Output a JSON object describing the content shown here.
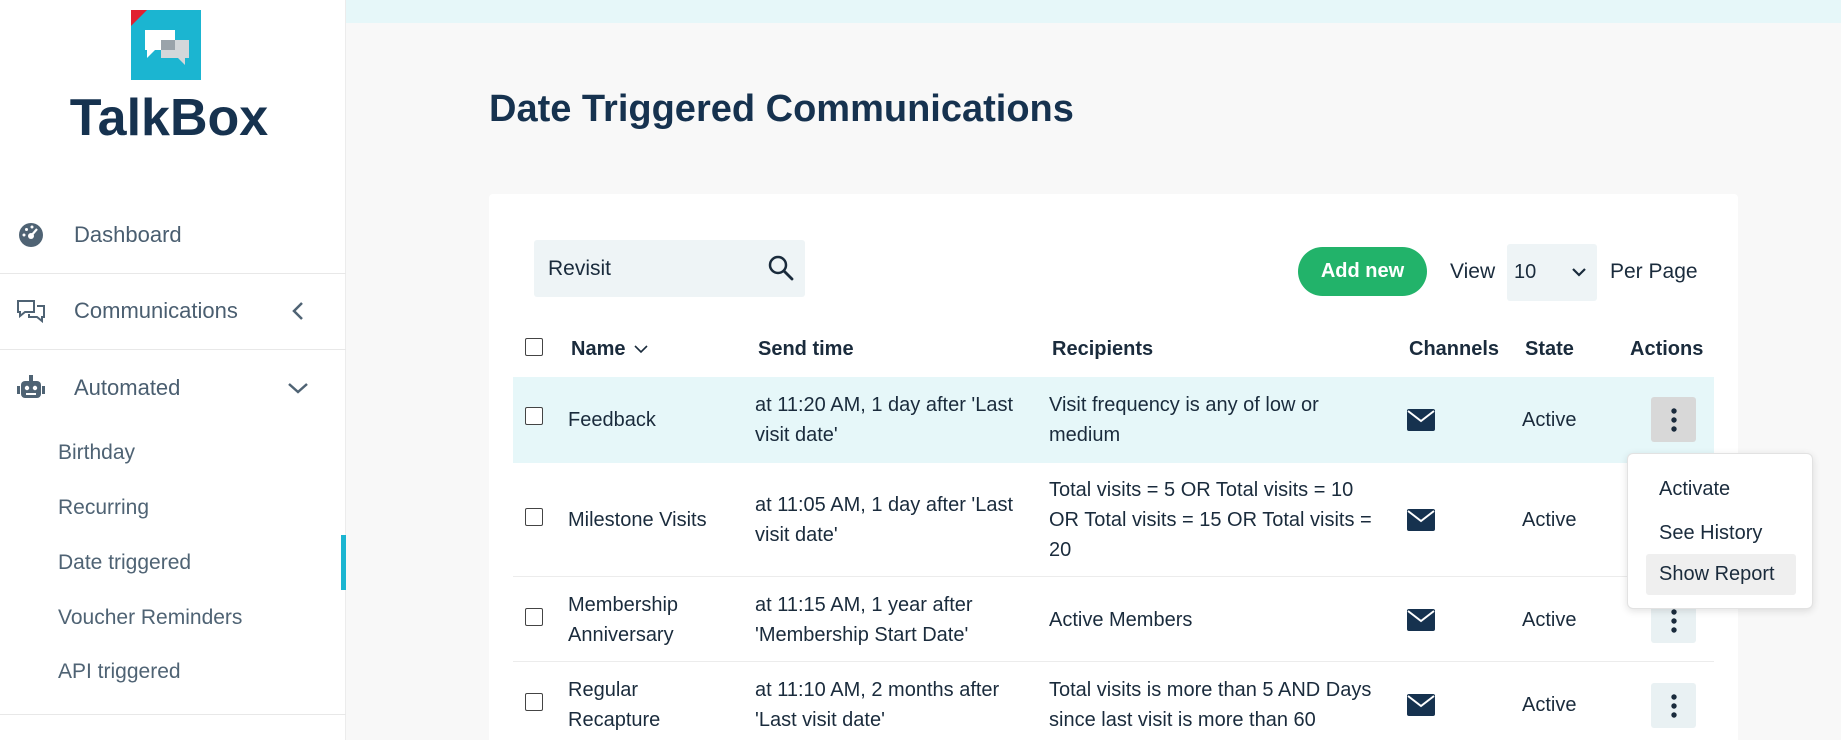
{
  "app": {
    "logo_text": "TalkBox"
  },
  "sidebar": {
    "nav": [
      {
        "label": "Dashboard",
        "icon": "dashboard-icon"
      },
      {
        "label": "Communications",
        "icon": "chat-icon"
      },
      {
        "label": "Automated",
        "icon": "robot-icon"
      }
    ],
    "sub_items": [
      {
        "label": "Birthday"
      },
      {
        "label": "Recurring"
      },
      {
        "label": "Date triggered"
      },
      {
        "label": "Voucher Reminders"
      },
      {
        "label": "API triggered"
      }
    ],
    "active_sub": "Date triggered"
  },
  "page": {
    "title": "Date Triggered Communications"
  },
  "toolbar": {
    "search_value": "Revisit",
    "add_label": "Add new",
    "view_label": "View",
    "per_page_value": "10",
    "per_page_label": "Per Page"
  },
  "table": {
    "headers": {
      "name": "Name",
      "send_time": "Send time",
      "recipients": "Recipients",
      "channels": "Channels",
      "state": "State",
      "actions": "Actions"
    },
    "rows": [
      {
        "name": [
          "Feedback"
        ],
        "send_time": [
          "at 11:20 AM, 1 day after 'Last",
          "visit date'"
        ],
        "recipients": [
          "Visit frequency is any of low or",
          "medium"
        ],
        "channel": "email-icon",
        "state": "Active"
      },
      {
        "name": [
          "Milestone Visits"
        ],
        "send_time": [
          "at 11:05 AM, 1 day after 'Last",
          "visit date'"
        ],
        "recipients": [
          "Total visits = 5 OR Total visits = 10",
          "OR Total visits = 15 OR Total visits =",
          "20"
        ],
        "channel": "email-icon",
        "state": "Active"
      },
      {
        "name": [
          "Membership",
          "Anniversary"
        ],
        "send_time": [
          "at 11:15 AM, 1 year after",
          "'Membership Start Date'"
        ],
        "recipients": [
          "Active Members"
        ],
        "channel": "email-icon",
        "state": "Active"
      },
      {
        "name": [
          "Regular",
          "Recapture"
        ],
        "send_time": [
          "at 11:10 AM, 2 months after",
          "'Last visit date'"
        ],
        "recipients": [
          "Total visits is more than 5 AND Days",
          "since last visit is more than 60"
        ],
        "channel": "email-icon",
        "state": "Active"
      }
    ]
  },
  "actions_menu": {
    "items": [
      {
        "label": "Activate"
      },
      {
        "label": "See History"
      },
      {
        "label": "Show Report"
      }
    ],
    "highlighted": "Show Report"
  },
  "colors": {
    "brand": "#1bb5d1",
    "navy": "#16324f",
    "green": "#22b36a",
    "highlight_row": "#e6f7f9"
  }
}
